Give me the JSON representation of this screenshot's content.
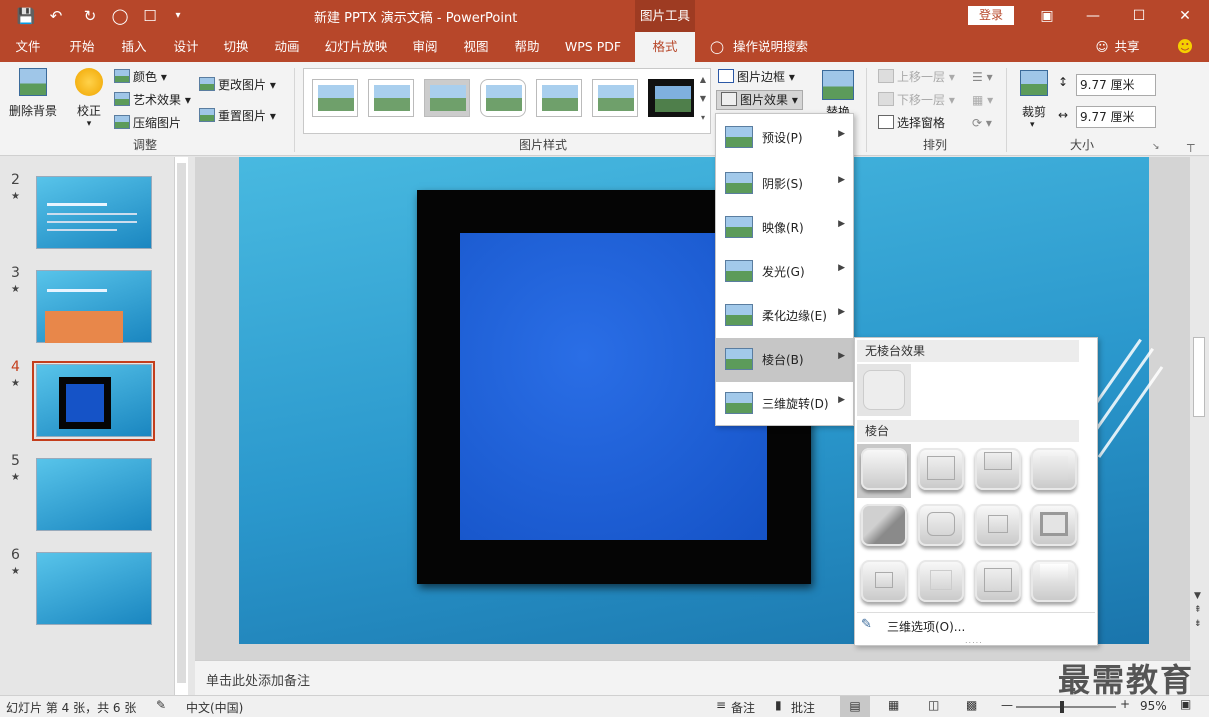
{
  "window": {
    "title": "新建 PPTX 演示文稿 - PowerPoint",
    "context_tab": "图片工具",
    "login": "登录"
  },
  "tabs": [
    "文件",
    "开始",
    "插入",
    "设计",
    "切换",
    "动画",
    "幻灯片放映",
    "审阅",
    "视图",
    "帮助",
    "WPS PDF",
    "格式"
  ],
  "active_tab": "格式",
  "tell_me": "操作说明搜索",
  "share": "共享",
  "ribbon": {
    "remove_bg": "删除背景",
    "correct": "校正",
    "color": "颜色",
    "artistic": "艺术效果",
    "compress": "压缩图片",
    "change_pic": "更改图片",
    "reset_pic": "重置图片",
    "group_adjust": "调整",
    "group_styles": "图片样式",
    "border": "图片边框",
    "effects": "图片效果",
    "replace": "替换",
    "bring_forward": "上移一层",
    "send_backward": "下移一层",
    "selection_pane": "选择窗格",
    "group_arrange": "排列",
    "crop": "裁剪",
    "height": "9.77 厘米",
    "width": "9.77 厘米",
    "group_size": "大小"
  },
  "effects_menu": [
    {
      "label": "预设(P)"
    },
    {
      "label": "阴影(S)"
    },
    {
      "label": "映像(R)"
    },
    {
      "label": "发光(G)"
    },
    {
      "label": "柔化边缘(E)"
    },
    {
      "label": "棱台(B)"
    },
    {
      "label": "三维旋转(D)"
    }
  ],
  "bevel_sub": {
    "no_bevel": "无棱台效果",
    "bevel": "棱台",
    "options": "三维选项(O)..."
  },
  "slides": [
    {
      "num": "2",
      "star": "★"
    },
    {
      "num": "3",
      "star": "★"
    },
    {
      "num": "4",
      "star": "★"
    },
    {
      "num": "5",
      "star": "★"
    },
    {
      "num": "6",
      "star": "★"
    }
  ],
  "notes_placeholder": "单击此处添加备注",
  "status": {
    "slide_info": "幻灯片 第 4 张，共 6 张",
    "language": "中文(中国)",
    "notes": "备注",
    "comments": "批注",
    "zoom": "95%"
  },
  "watermark": "最需教育",
  "colors": {
    "accent": "#b7472a",
    "slide_bg": "#2a97cc",
    "picture": "#1553c7"
  }
}
